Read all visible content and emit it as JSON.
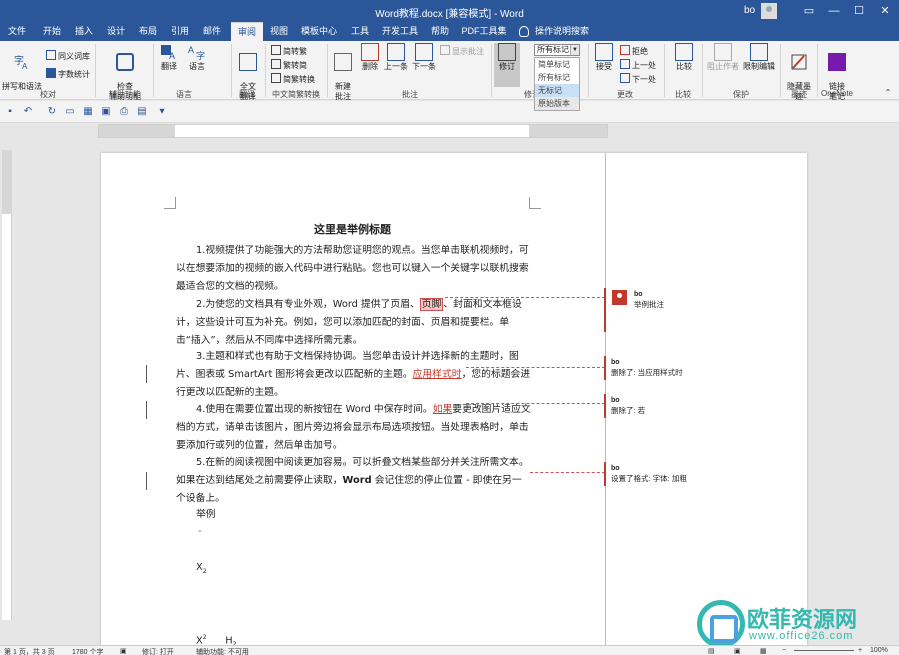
{
  "window": {
    "title": "Word教程.docx [兼容模式] - Word",
    "user": "bo"
  },
  "tabs": [
    {
      "label": "文件"
    },
    {
      "label": "开始"
    },
    {
      "label": "插入"
    },
    {
      "label": "设计"
    },
    {
      "label": "布局"
    },
    {
      "label": "引用"
    },
    {
      "label": "邮件"
    },
    {
      "label": "审阅"
    },
    {
      "label": "视图"
    },
    {
      "label": "模板中心"
    },
    {
      "label": "工具"
    },
    {
      "label": "开发工具"
    },
    {
      "label": "帮助"
    },
    {
      "label": "PDF工具集"
    },
    {
      "label": "操作说明搜索"
    }
  ],
  "ribbon": {
    "spelling": "拼写和语法",
    "thesaurus": "同义词库",
    "word_count": "字数统计",
    "accessibility": "检查\n辅助功能",
    "translate": "翻译",
    "language": "语言",
    "fulltext_translate": "全文\n翻译",
    "to_traditional": "简转繁",
    "to_simplified": "繁转简",
    "sc_tc_convert": "简繁转换",
    "new_comment": "新建\n批注",
    "delete": "删除",
    "prev": "上一条",
    "next": "下一条",
    "show_comments": "显示批注",
    "track_changes": "修订",
    "markup_value": "所有标记",
    "accept": "接受",
    "reject": "拒绝",
    "prev_change": "上一处",
    "next_change": "下一处",
    "compare": "比较",
    "block_authors": "阻止作者",
    "restrict_editing": "限制编辑",
    "hide_ink": "隐藏墨\n迹",
    "linked_notes": "链接\n笔记",
    "groups": {
      "proofing": "校对",
      "accessibility": "辅助功能",
      "language": "语言",
      "translate": "翻译",
      "chinese": "中文简繁转换",
      "comments": "批注",
      "tracking": "修订",
      "changes": "更改",
      "compare": "比较",
      "protect": "保护",
      "ink": "墨迹",
      "onenote": "OneNote"
    }
  },
  "markup_menu": [
    "简单标记",
    "所有标记",
    "无标记",
    "原始版本"
  ],
  "document": {
    "title": "这里是举例标题",
    "p1": "1.视频提供了功能强大的方法帮助您证明您的观点。当您单击联机视频时，可以在想要添加的视频的嵌入代码中进行粘贴。您也可以键入一个关键字以联机搜索最适合您的文档的视频。",
    "p2a": "2.为使您的文档具有专业外观，Word 提供了页眉、",
    "p2_comment": "页脚",
    "p2b": "、封面和文本框设计，这些设计可互为补充。例如，您可以添加匹配的封面、页眉和提要栏。单击“插入”，然后从不同库中选择所需元素。",
    "p3a": "3.主题和样式也有助于文档保持协调。当您单击设计并选择新的主题时，图片、图表或 SmartArt 图形将会更改以匹配新的主题。",
    "p3_rev": "应用样式时",
    "p3b": "，您的标题会进行更改以匹配新的主题。",
    "p4a": "4.使用在需要位置出现的新按钮在 Word 中保存时间。",
    "p4_rev": "如果",
    "p4b": "要更改图片适应文档的方式，请单击该图片，图片旁边将会显示布局选项按钮。当处理表格时，单击要添加行或列的位置，然后单击加号。",
    "p5a": "5.在新的阅读视图中阅读更加容易。可以折叠文档某些部分并关注所需文本。如果在达到结尾处之前需要停止读取，",
    "p5_bold": "Word",
    "p5b": " 会记住您的停止位置 - 即使在另一个设备上。",
    "example": "举例",
    "x_sub": "X",
    "x2": "X",
    "h2": "H"
  },
  "comments": [
    {
      "author": "bo",
      "text": "举例批注"
    },
    {
      "author": "bo",
      "text": "删除了: 当应用样式时"
    },
    {
      "author": "bo",
      "text": "删除了: 若"
    },
    {
      "author": "bo",
      "text": "设置了格式: 字体: 加粗"
    }
  ],
  "statusbar": {
    "page": "第 1 页，共 3 页",
    "words": "1780 个字",
    "track": "修订: 打开",
    "accessibility": "辅助功能: 不可用",
    "zoom": "100%"
  },
  "watermark": {
    "text": "欧菲资源网",
    "url": "www.office26.com"
  },
  "colors": {
    "titlebar": "#2b579a",
    "revision": "#c0392b",
    "watermark": "#35b8b0"
  }
}
